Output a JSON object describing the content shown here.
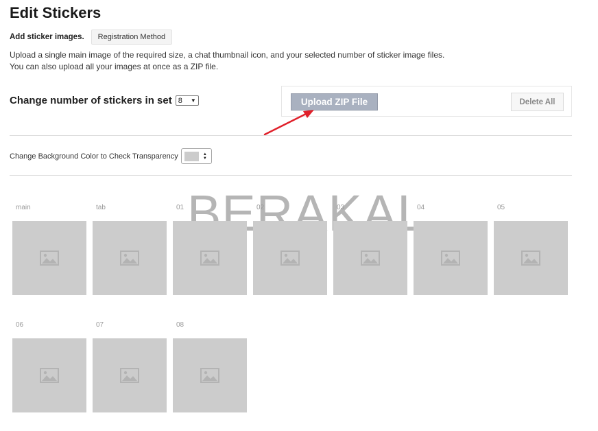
{
  "header": {
    "title": "Edit Stickers",
    "add_label": "Add sticker images.",
    "registration_button": "Registration Method"
  },
  "description": {
    "line1": "Upload a single main image of the required size, a chat thumbnail icon, and your selected number of sticker image files.",
    "line2": "You can also upload all your images at once as a ZIP file."
  },
  "count": {
    "label": "Change number of stickers in set",
    "selected": "8"
  },
  "upload": {
    "zip_button": "Upload ZIP File",
    "delete_button": "Delete All"
  },
  "background": {
    "label": "Change Background Color to Check Transparency",
    "swatch_color": "#cccccc"
  },
  "watermark": "BERAKAL",
  "stickers": {
    "labels": [
      "main",
      "tab",
      "01",
      "02",
      "03",
      "04",
      "05",
      "06",
      "07",
      "08"
    ],
    "placeholder_icon": "image-placeholder-icon",
    "placeholder_color": "#cccccc"
  },
  "annotation": {
    "arrow_color": "#e0202a"
  }
}
